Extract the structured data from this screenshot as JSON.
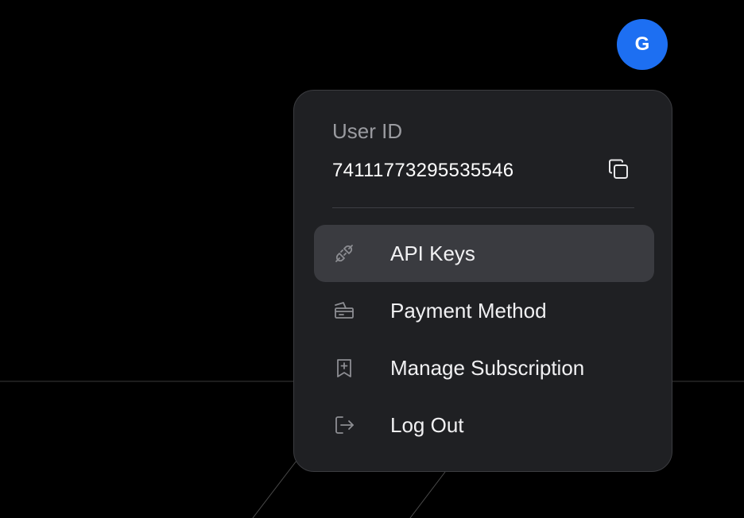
{
  "avatar": {
    "initial": "G",
    "color": "#1d6ff2"
  },
  "user_menu": {
    "user_id_label": "User ID",
    "user_id_value": "74111773295535546",
    "copy_icon": "copy-icon",
    "items": [
      {
        "label": "API Keys",
        "icon": "plug-icon",
        "active": true
      },
      {
        "label": "Payment Method",
        "icon": "payment-card-icon",
        "active": false
      },
      {
        "label": "Manage Subscription",
        "icon": "bookmark-plus-icon",
        "active": false
      },
      {
        "label": "Log Out",
        "icon": "logout-icon",
        "active": false
      }
    ]
  },
  "colors": {
    "background": "#000000",
    "menu_background": "#1f2023",
    "active_item": "#3a3b40",
    "muted_text": "#9a9ba0"
  }
}
